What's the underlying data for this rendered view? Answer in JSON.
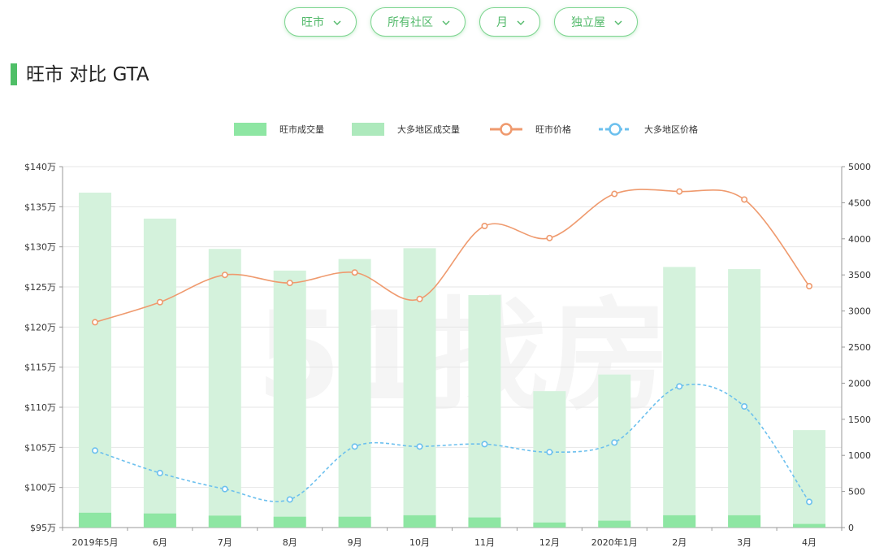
{
  "filters": [
    {
      "label": "旺市"
    },
    {
      "label": "所有社区"
    },
    {
      "label": "月"
    },
    {
      "label": "独立屋"
    }
  ],
  "page_title": "旺市 对比 GTA",
  "watermark": "51找房",
  "colors": {
    "accent": "#4fbf67",
    "bar_local": "#8ee6a3",
    "bar_region": "#d4f2dc",
    "line_local": "#ef9a6e",
    "line_region": "#6cc0ee"
  },
  "chart_data": {
    "type": "bar",
    "categories": [
      "2019年5月",
      "6月",
      "7月",
      "8月",
      "9月",
      "10月",
      "11月",
      "12月",
      "2020年1月",
      "2月",
      "3月",
      "4月"
    ],
    "series": [
      {
        "name": "旺市成交量",
        "kind": "bar",
        "axis": "right",
        "values": [
          205,
          195,
          165,
          150,
          150,
          170,
          140,
          70,
          95,
          170,
          170,
          50
        ]
      },
      {
        "name": "大多地区成交量",
        "kind": "bar",
        "axis": "right",
        "values": [
          4640,
          4280,
          3860,
          3560,
          3720,
          3870,
          3220,
          1890,
          2120,
          3610,
          3580,
          1350
        ]
      },
      {
        "name": "旺市价格",
        "kind": "line",
        "axis": "left",
        "unit": "万",
        "values": [
          120.6,
          123.1,
          126.5,
          125.5,
          126.8,
          123.5,
          132.6,
          131.1,
          136.6,
          136.9,
          135.9,
          125.1
        ]
      },
      {
        "name": "大多地区价格",
        "kind": "line",
        "axis": "left",
        "unit": "万",
        "dashed": true,
        "values": [
          104.6,
          101.8,
          99.8,
          98.5,
          105.1,
          105.1,
          105.4,
          104.4,
          105.6,
          112.6,
          110.1,
          98.2
        ]
      }
    ],
    "left_axis": {
      "ylim": [
        95,
        140
      ],
      "ticks": [
        "$95万",
        "$100万",
        "$105万",
        "$110万",
        "$115万",
        "$120万",
        "$125万",
        "$130万",
        "$135万",
        "$140万"
      ]
    },
    "right_axis": {
      "ylim": [
        0,
        5000
      ],
      "ticks": [
        "0",
        "500",
        "1000",
        "1500",
        "2000",
        "2500",
        "3000",
        "3500",
        "4000",
        "4500",
        "5000"
      ]
    },
    "legend_position": "top-center",
    "grid": true
  }
}
